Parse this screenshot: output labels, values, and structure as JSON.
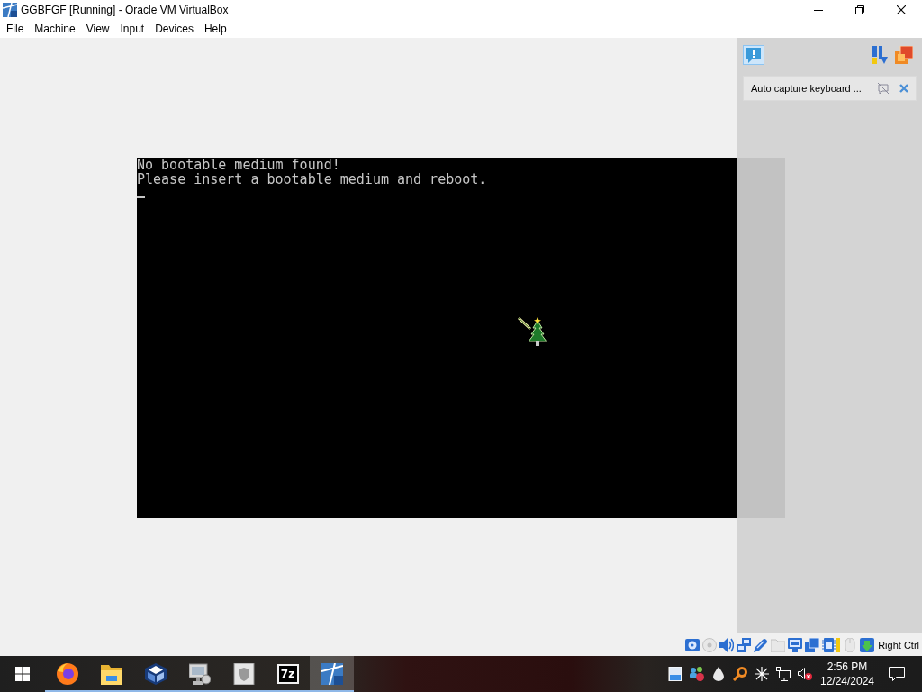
{
  "window": {
    "title": "GGBFGF [Running] - Oracle VM VirtualBox"
  },
  "menu": [
    "File",
    "Machine",
    "View",
    "Input",
    "Devices",
    "Help"
  ],
  "vm_screen": {
    "lines": [
      "No bootable medium found!",
      "Please insert a bootable medium and reboot."
    ]
  },
  "notification_panel": {
    "messages": [
      {
        "text": "Auto capture keyboard ..."
      }
    ]
  },
  "status_bar": {
    "indicators": [
      {
        "kind": "hard_disk",
        "disabled": false
      },
      {
        "kind": "optical",
        "disabled": true
      },
      {
        "kind": "audio",
        "disabled": false
      },
      {
        "kind": "network",
        "disabled": false
      },
      {
        "kind": "usb",
        "disabled": false
      },
      {
        "kind": "shared_folders",
        "disabled": true
      },
      {
        "kind": "display",
        "disabled": false
      },
      {
        "kind": "capture",
        "disabled": false
      },
      {
        "kind": "cpu",
        "disabled": false
      },
      {
        "kind": "mouse",
        "disabled": true
      },
      {
        "kind": "keyboard",
        "disabled": false
      }
    ],
    "host_key": "Right Ctrl"
  },
  "taskbar": {
    "apps": [
      {
        "kind": "browser",
        "running": true,
        "selected": false
      },
      {
        "kind": "folder",
        "running": true,
        "selected": false
      },
      {
        "kind": "cube",
        "running": true,
        "selected": false
      },
      {
        "kind": "computer",
        "running": true,
        "selected": false
      },
      {
        "kind": "shield",
        "running": true,
        "selected": false
      },
      {
        "kind": "archiver",
        "label": "7z",
        "running": true,
        "selected": false
      },
      {
        "kind": "vm",
        "running": true,
        "selected": true
      }
    ],
    "tray": {
      "speaker_muted": true
    },
    "clock": {
      "time": "2:56 PM",
      "date": "12/24/2024"
    }
  }
}
